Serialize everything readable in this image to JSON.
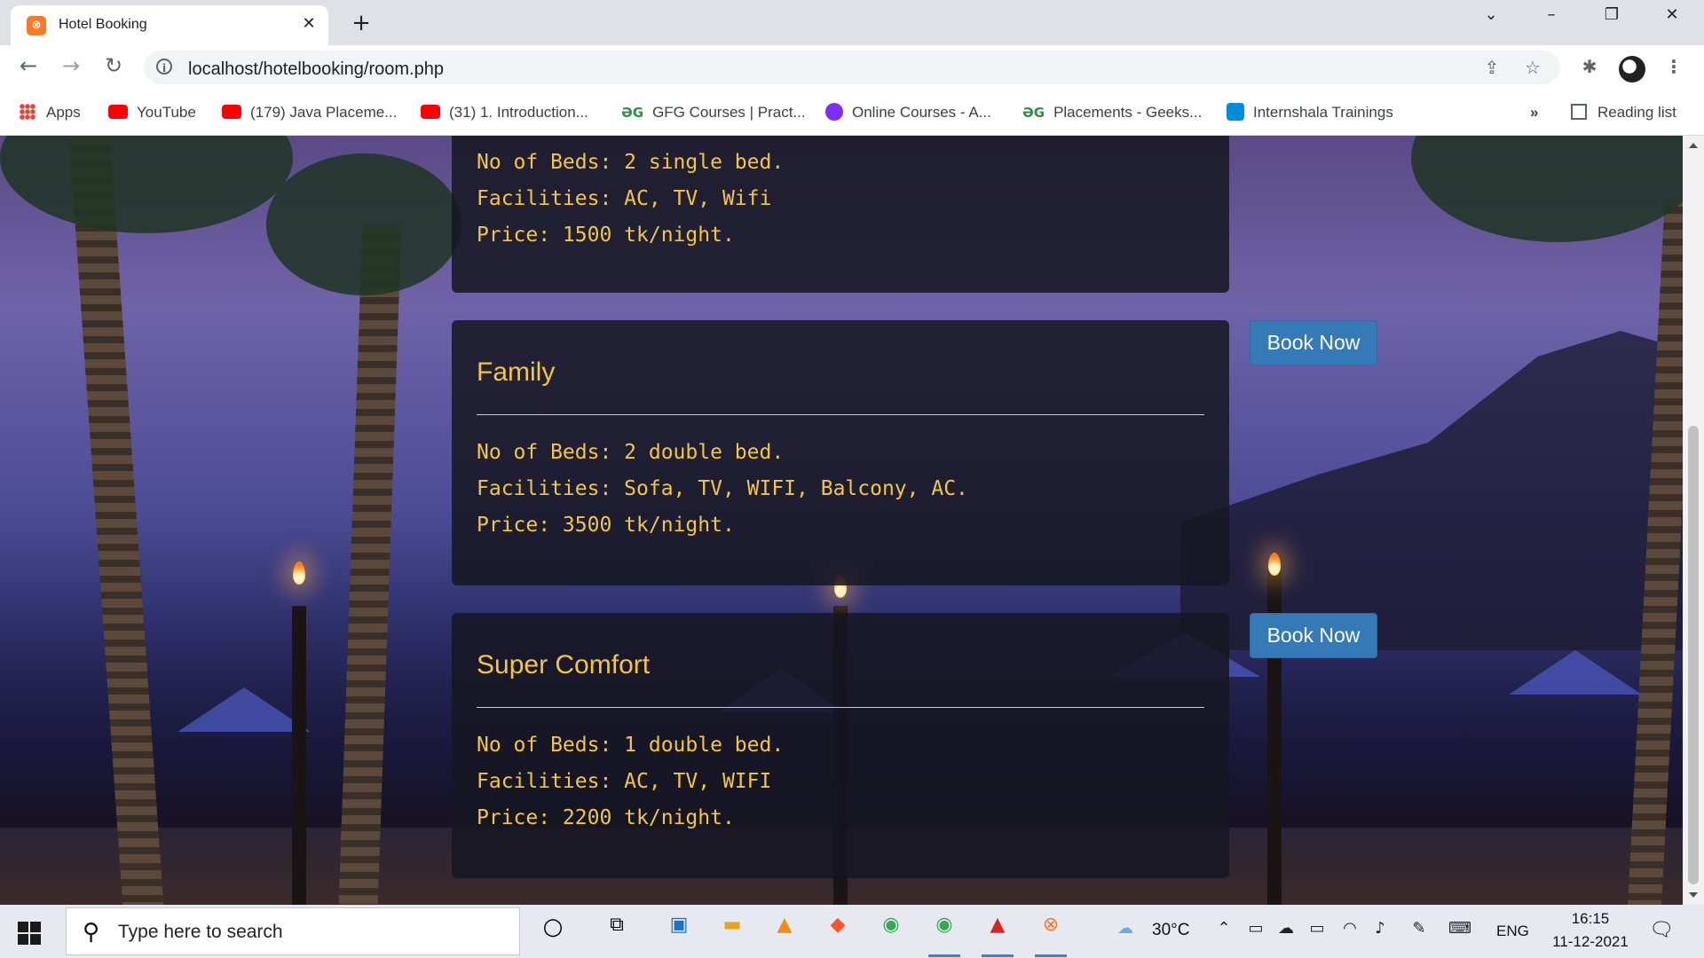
{
  "browser": {
    "tab_title": "Hotel Booking",
    "url": "localhost/hotelbooking/room.php",
    "bookmarks": [
      {
        "label": "Apps",
        "icon": "apps-grid-icon"
      },
      {
        "label": "YouTube",
        "icon": "youtube-icon"
      },
      {
        "label": "(179) Java Placeme...",
        "icon": "youtube-icon"
      },
      {
        "label": "(31) 1. Introduction...",
        "icon": "youtube-icon"
      },
      {
        "label": "GFG Courses | Pract...",
        "icon": "gfg-icon"
      },
      {
        "label": "Online Courses - A...",
        "icon": "online-courses-icon"
      },
      {
        "label": "Placements - Geeks...",
        "icon": "gfg-icon"
      },
      {
        "label": "Internshala Trainings",
        "icon": "internshala-icon"
      }
    ],
    "more_bookmarks": "»",
    "reading_list": "Reading list"
  },
  "rooms": [
    {
      "name": "",
      "beds": "No of Beds: 2 single bed.",
      "facilities": "Facilities: AC, TV, Wifi",
      "price": "Price: 1500 tk/night."
    },
    {
      "name": "Family",
      "beds": "No of Beds: 2 double bed.",
      "facilities": "Facilities: Sofa, TV, WIFI, Balcony, AC.",
      "price": "Price: 3500 tk/night.",
      "button": "Book Now"
    },
    {
      "name": "Super Comfort",
      "beds": "No of Beds: 1 double bed.",
      "facilities": "Facilities: AC, TV, WIFI",
      "price": "Price: 2200 tk/night.",
      "button": "Book Now"
    }
  ],
  "taskbar": {
    "search_placeholder": "Type here to search",
    "weather": "30°C",
    "language": "ENG",
    "time": "16:15",
    "date": "11-12-2021"
  },
  "colors": {
    "room_text": "#f3c641",
    "book_button": "#337ab7",
    "card_bg": "#161622"
  }
}
